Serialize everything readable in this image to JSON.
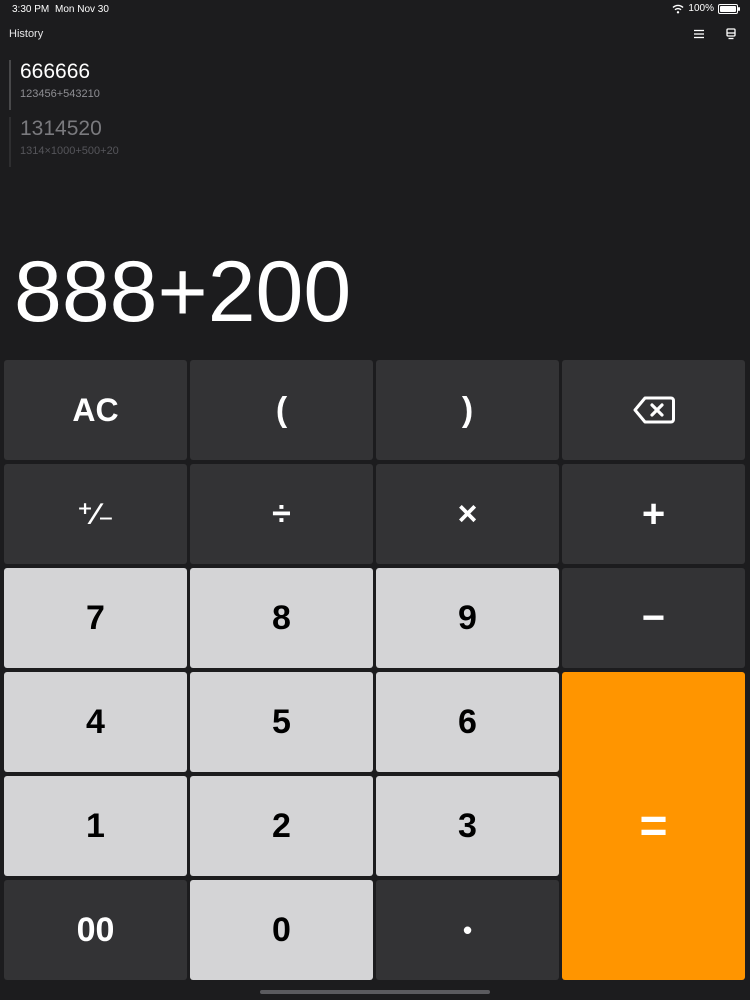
{
  "status_bar": {
    "time": "3:30 PM",
    "date": "Mon Nov 30",
    "battery": "100%",
    "icons": [
      "wifi-icon",
      "battery-icon"
    ]
  },
  "header": {
    "title": "History",
    "icons": [
      "list-icon",
      "panel-icon"
    ]
  },
  "history": [
    {
      "result": "666666",
      "expression": "123456+543210"
    },
    {
      "result": "1314520",
      "expression": "1314×1000+500+20"
    }
  ],
  "display": {
    "expression": "888+200"
  },
  "keypad": {
    "ac": "AC",
    "open_paren": "(",
    "close_paren": ")",
    "backspace": "backspace-icon",
    "plus_minus": "⁺∕₋",
    "divide": "÷",
    "multiply": "×",
    "add": "+",
    "subtract": "−",
    "seven": "7",
    "eight": "8",
    "nine": "9",
    "four": "4",
    "five": "5",
    "six": "6",
    "one": "1",
    "two": "2",
    "three": "3",
    "double_zero": "00",
    "zero": "0",
    "decimal": "•",
    "equals": "="
  },
  "colors": {
    "background": "#1c1c1e",
    "key_dark": "#333335",
    "key_light": "#d4d4d6",
    "accent": "#ff9500"
  }
}
